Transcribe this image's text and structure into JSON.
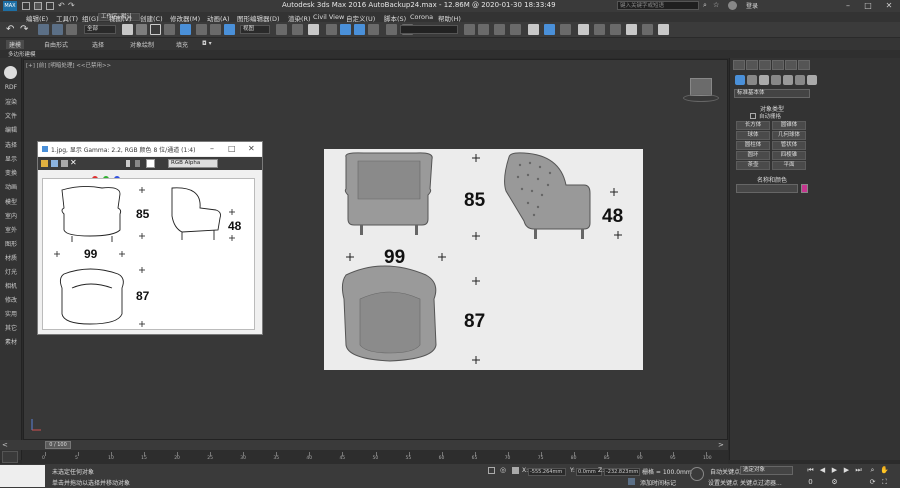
{
  "titlebar": {
    "app_logo": "MAX",
    "title": "Autodesk 3ds Max 2016     AutoBackup24.max - 12.86M @ 2020-01-30 18:33:49",
    "search_placeholder": "键入关键字或短语",
    "login": "登录"
  },
  "menubar": {
    "items": [
      "编辑(E)",
      "工具(T)",
      "组(G)",
      "视图(V)",
      "创建(C)",
      "修改器(M)",
      "动画(A)",
      "图形编辑器(D)",
      "渲染(R)",
      "Civil View",
      "自定义(U)",
      "脚本(S)",
      "Corona",
      "帮助(H)"
    ],
    "workspace": "工作区: 默认"
  },
  "toolbar": {
    "filter": "全部",
    "view": "视图"
  },
  "ribbon": {
    "tabs": [
      "建模",
      "自由形式",
      "选择",
      "对象绘制",
      "填充"
    ],
    "sub_label": "多边形建模"
  },
  "leftcol": {
    "items": [
      "RDF",
      "渲染",
      "文件",
      "编辑",
      "选择",
      "显示",
      "变换",
      "动画",
      "模型",
      "室内",
      "室外",
      "图形",
      "材质",
      "灯光",
      "相机",
      "修改",
      "实用",
      "其它",
      "素材"
    ]
  },
  "viewport": {
    "label": "[+] [前] [明暗处理] <<已禁用>>"
  },
  "floatwin": {
    "title": "1.jpg, 显示 Gamma: 2.2, RGB 颜色 8 位/通道 (1:4)",
    "channel": "RGB Alpha",
    "dims": {
      "width_front": "85",
      "width_side": "48",
      "depth_top": "99",
      "height_top": "87"
    }
  },
  "refimg": {
    "dims": {
      "width_front": "85",
      "width_side": "48",
      "depth_top": "99",
      "height_top": "87"
    }
  },
  "rightpanel": {
    "dropdown": "标准基本体",
    "section_object_type": "对象类型",
    "autogrid": "自动栅格",
    "buttons": [
      "长方体",
      "圆锥体",
      "球体",
      "几何球体",
      "圆柱体",
      "管状体",
      "圆环",
      "四棱锥",
      "茶壶",
      "平面"
    ],
    "section_name_color": "名称和颜色"
  },
  "timeline": {
    "frame": "0 / 100",
    "ticks": [
      "0",
      "5",
      "10",
      "15",
      "20",
      "25",
      "30",
      "35",
      "40",
      "45",
      "50",
      "55",
      "60",
      "65",
      "70",
      "75",
      "80",
      "85",
      "90",
      "95",
      "100"
    ]
  },
  "statusbar": {
    "line1": "未选定任何对象",
    "line2": "单击并拖动以选择并移动对象",
    "x": "-555.264mm",
    "y": "0.0mm",
    "z": "-232.823mm",
    "grid": "栅格 = 100.0mm",
    "add_time_tag": "添加时间标记",
    "autokey": "自动关键点",
    "set_key": "设置关键点",
    "selected": "选定对象",
    "key_filter": "关键点过滤器..."
  },
  "colors": {
    "accent": "#1d6fa5",
    "active_blue": "#4a90d9",
    "swatch": "#c6368f"
  }
}
